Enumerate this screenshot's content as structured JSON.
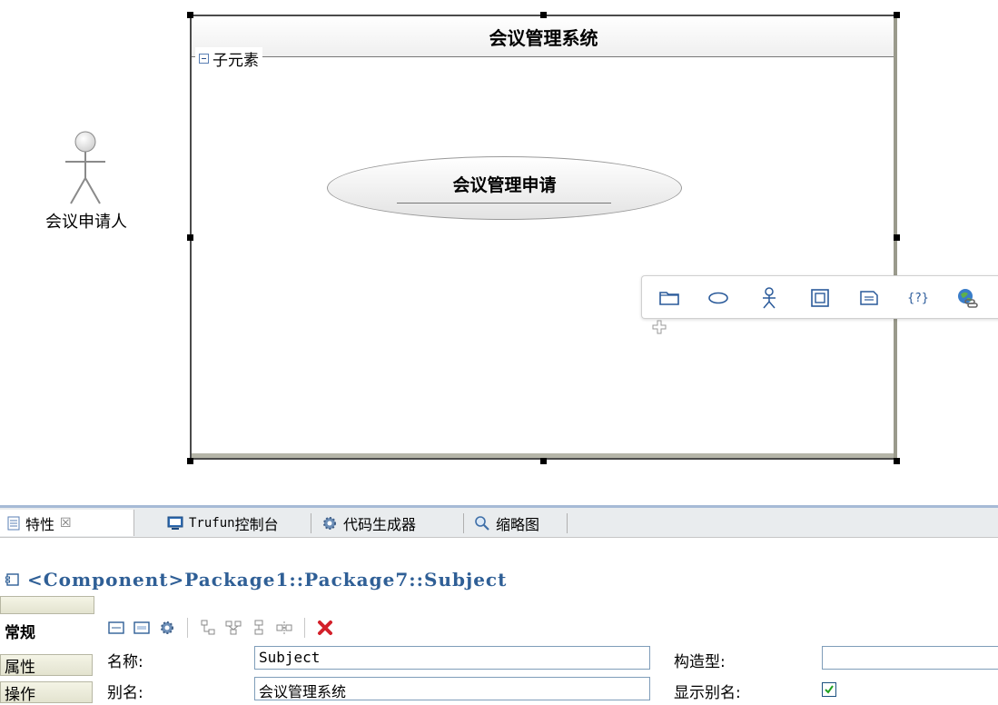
{
  "diagram": {
    "actor": {
      "label": "会议申请人"
    },
    "system": {
      "title": "会议管理系统",
      "compartment_label": "子元素"
    },
    "usecase": {
      "name": "会议管理申请"
    },
    "palette": {
      "tools": [
        "package-tool-icon",
        "usecase-tool-icon",
        "actor-tool-icon",
        "subject-tool-icon",
        "note-tool-icon",
        "constraint-tool-icon",
        "hyperlink-tool-icon"
      ],
      "constraint_label": "{?}"
    }
  },
  "properties_view": {
    "tabs": [
      {
        "label": "特性",
        "active": true
      },
      {
        "label_prefix": "Trufun",
        "label": "控制台",
        "active": false
      },
      {
        "label": "代码生成器",
        "active": false
      },
      {
        "label": "缩略图",
        "active": false
      }
    ],
    "close_symbol": "☒",
    "title": "<Component>Package1::Package7::Subject",
    "side_tabs": [
      {
        "label": "常规",
        "active": true
      },
      {
        "label": "属性",
        "active": false
      },
      {
        "label": "操作",
        "active": false
      }
    ],
    "fields": {
      "name_label": "名称:",
      "name_value": "Subject",
      "alias_label": "别名:",
      "alias_value": "会议管理系统",
      "stereotype_label": "构造型:",
      "stereotype_value": "",
      "show_alias_label": "显示别名:",
      "show_alias_checked": true
    },
    "colors": {
      "title": "#2f5f96",
      "tab_bar": "#e9ecee",
      "accent_line": "#a6bad6"
    }
  }
}
